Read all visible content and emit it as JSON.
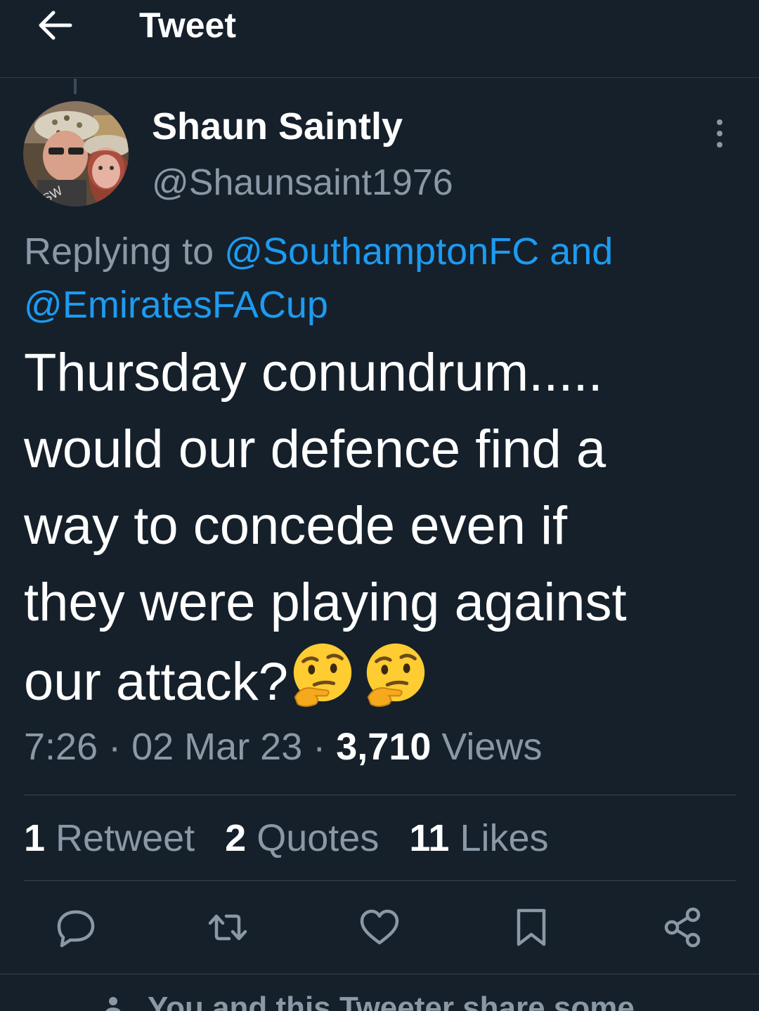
{
  "header": {
    "title": "Tweet",
    "back_icon": "arrow-left-icon"
  },
  "author": {
    "name": "Shaun Saintly",
    "handle": "@Shaunsaint1976",
    "avatar_icon": "avatar"
  },
  "reply": {
    "prefix": "Replying to ",
    "mention1": "@SouthamptonFC",
    "conjunction": " and",
    "mention2": "@EmiratesFACup"
  },
  "tweet": {
    "line1": "Thursday conundrum.....",
    "line2": "would our defence find a",
    "line3": "way to concede even if",
    "line4": "they were playing against",
    "line5": "our attack?",
    "emoji_icons": [
      "thinking-face-icon",
      "thinking-face-icon"
    ]
  },
  "meta": {
    "time": "7:26",
    "sep1": " · ",
    "date": "02 Mar 23",
    "sep2": " · ",
    "views_count": "3,710",
    "views_label": " Views"
  },
  "stats": [
    {
      "count": "1",
      "label": " Retweet"
    },
    {
      "count": "2",
      "label": " Quotes"
    },
    {
      "count": "11",
      "label": " Likes"
    }
  ],
  "actions": [
    "reply-icon",
    "retweet-icon",
    "like-icon",
    "bookmark-icon",
    "share-icon"
  ],
  "notice": {
    "text": "You and this Tweeter share some"
  },
  "colors": {
    "background": "#15202b",
    "link": "#1d9bf0",
    "secondary_text": "#8b98a5",
    "divider": "#38444d"
  }
}
